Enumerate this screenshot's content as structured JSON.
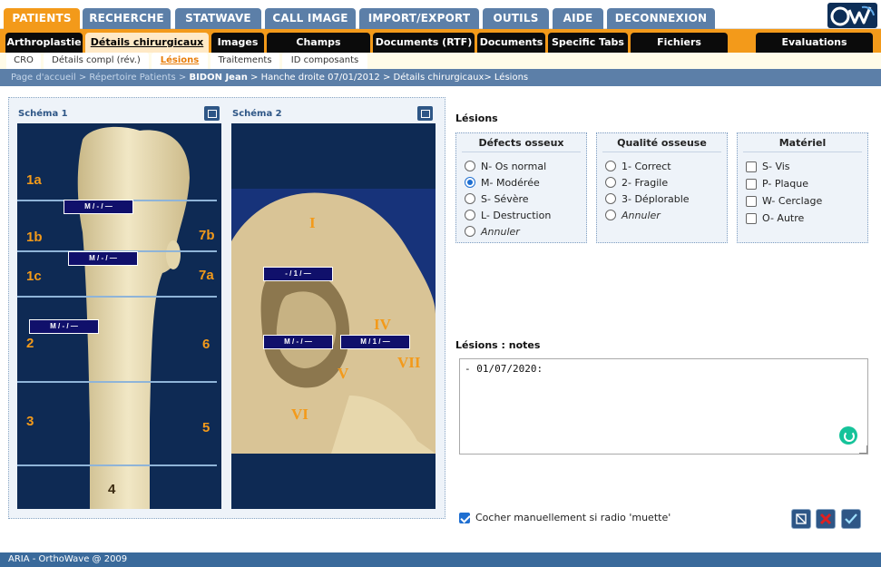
{
  "nav": {
    "top_tabs": [
      "PATIENTS",
      "RECHERCHE",
      "STATWAVE",
      "CALL IMAGE",
      "IMPORT/EXPORT",
      "OUTILS",
      "AIDE",
      "DECONNEXION"
    ],
    "sub_tabs": [
      "Arthroplastie",
      "Détails chirurgicaux",
      "Images",
      "Champs utilisateur",
      "Documents (RTF)",
      "Documents",
      "Specific Tabs",
      "Fichiers externes",
      "Evaluations cliniques"
    ],
    "third_tabs": [
      "CRO",
      "Détails compl (rév.)",
      "Lésions",
      "Traitements",
      "ID composants"
    ]
  },
  "breadcrumb": {
    "part1": "Page d'accueil > Répertoire Patients >",
    "patient": "BIDON Jean",
    "part2": "> Hanche droite 07/01/2012 > Détails chirurgicaux> Lésions"
  },
  "schema1": {
    "title": "Schéma 1",
    "zones": [
      "1a",
      "1b",
      "1c",
      "2",
      "3",
      "4",
      "5",
      "6",
      "7a",
      "7b"
    ],
    "tags": [
      "M / - / —",
      "M / - / —",
      "M / - / —"
    ]
  },
  "schema2": {
    "title": "Schéma 2",
    "zones": [
      "I",
      "IV",
      "V",
      "VI",
      "VII"
    ],
    "tags": [
      "- / 1 / —",
      "M / - / —",
      "M / 1 / —"
    ]
  },
  "lesions": {
    "title": "Lésions",
    "defects": {
      "legend": "Défects osseux",
      "options": [
        "N- Os normal",
        "M- Modérée",
        "S- Sévère",
        "L- Destruction",
        "Annuler"
      ],
      "selected": "M- Modérée"
    },
    "quality": {
      "legend": "Qualité osseuse",
      "options": [
        "1- Correct",
        "2- Fragile",
        "3- Déplorable",
        "Annuler"
      ]
    },
    "material": {
      "legend": "Matériel",
      "options": [
        "S- Vis",
        "P- Plaque",
        "W- Cerclage",
        "O- Autre"
      ]
    }
  },
  "notes": {
    "title": "Lésions : notes",
    "value": "- 01/07/2020:"
  },
  "manual": {
    "label": "Cocher manuellement si radio 'muette'",
    "checked": true
  },
  "footer": "ARIA - OrthoWave @ 2009",
  "colors": {
    "accent": "#f39a1a",
    "nav": "#5c7fa8",
    "dark": "#0e2a54"
  }
}
